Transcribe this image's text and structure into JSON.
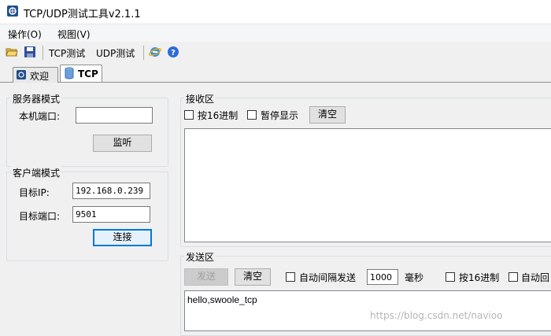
{
  "window": {
    "title": "TCP/UDP测试工具v2.1.1"
  },
  "menu": {
    "items": [
      "操作(O)",
      "视图(V)"
    ]
  },
  "toolbar": {
    "tcp_label": "TCP测试",
    "udp_label": "UDP测试"
  },
  "tabs": [
    {
      "label": "欢迎",
      "active": false
    },
    {
      "label": "TCP",
      "active": true
    }
  ],
  "server": {
    "group_title": "服务器模式",
    "port_label": "本机端口:",
    "port_value": "",
    "listen_button": "监听"
  },
  "client": {
    "group_title": "客户端模式",
    "ip_label": "目标IP:",
    "ip_value": "192.168.0.239",
    "port_label": "目标端口:",
    "port_value": "9501",
    "connect_button": "连接"
  },
  "receive": {
    "group_title": "接收区",
    "hex_label": "按16进制",
    "pause_label": "暂停显示",
    "clear_button": "清空",
    "content": ""
  },
  "send": {
    "group_title": "发送区",
    "send_button": "发送",
    "clear_button": "清空",
    "auto_send_label": "自动间隔发送",
    "interval_value": "1000",
    "interval_unit": "毫秒",
    "hex_label": "按16进制",
    "auto_reply_label": "自动回",
    "content": "hello,swoole_tcp"
  },
  "watermark": "https://blog.csdn.net/navioo"
}
